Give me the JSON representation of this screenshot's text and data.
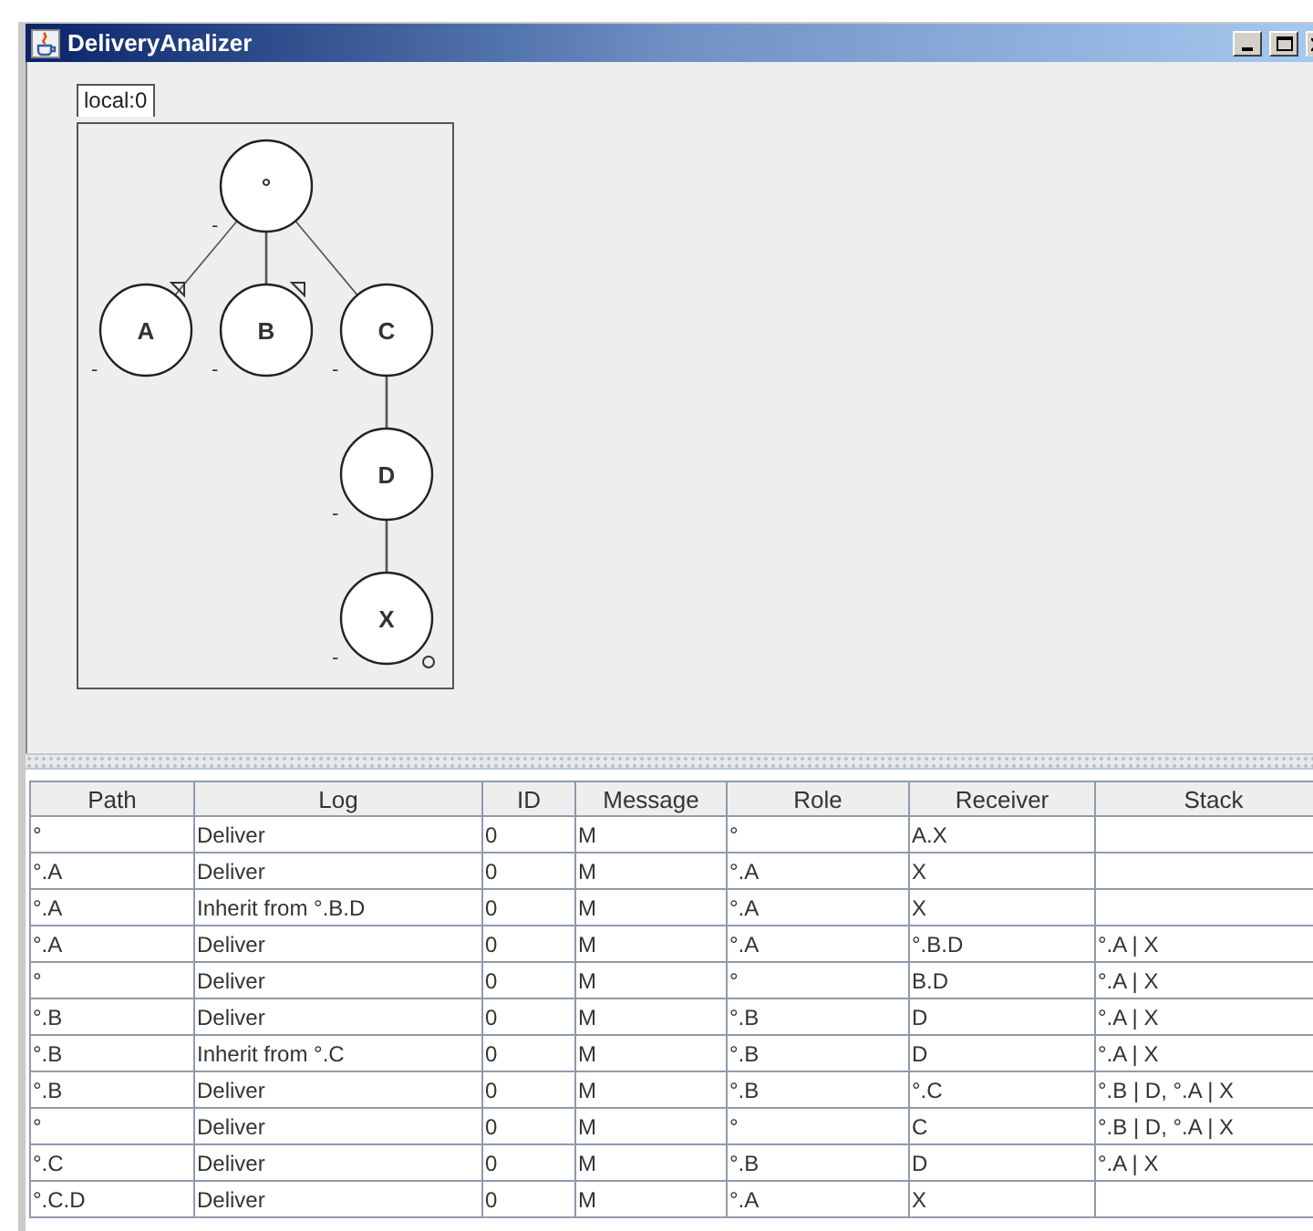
{
  "window": {
    "title": "DeliveryAnalizer"
  },
  "graph": {
    "tab": "local:0",
    "root": {
      "label": "°",
      "toggle": "-",
      "children": [
        {
          "label": "A",
          "toggle": "-",
          "kind": "flagged"
        },
        {
          "label": "B",
          "toggle": "-",
          "kind": "flagged"
        },
        {
          "label": "C",
          "toggle": "-",
          "children": [
            {
              "label": "D",
              "toggle": "-",
              "children": [
                {
                  "label": "X",
                  "toggle": "-",
                  "kind": "terminal"
                }
              ]
            }
          ]
        }
      ]
    }
  },
  "table": {
    "columns": [
      "Path",
      "Log",
      "ID",
      "Message",
      "Role",
      "Receiver",
      "Stack"
    ],
    "rows": [
      [
        "°",
        "Deliver",
        "0",
        "M",
        "°",
        "A.X",
        ""
      ],
      [
        "°.A",
        "Deliver",
        "0",
        "M",
        "°.A",
        "X",
        ""
      ],
      [
        "°.A",
        "Inherit from °.B.D",
        "0",
        "M",
        "°.A",
        "X",
        ""
      ],
      [
        "°.A",
        "Deliver",
        "0",
        "M",
        "°.A",
        "°.B.D",
        "°.A | X"
      ],
      [
        "°",
        "Deliver",
        "0",
        "M",
        "°",
        "B.D",
        "°.A | X"
      ],
      [
        "°.B",
        "Deliver",
        "0",
        "M",
        "°.B",
        "D",
        "°.A | X"
      ],
      [
        "°.B",
        "Inherit from °.C",
        "0",
        "M",
        "°.B",
        "D",
        "°.A | X"
      ],
      [
        "°.B",
        "Deliver",
        "0",
        "M",
        "°.B",
        "°.C",
        "°.B | D, °.A | X"
      ],
      [
        "°",
        "Deliver",
        "0",
        "M",
        "°",
        "C",
        "°.B | D, °.A | X"
      ],
      [
        "°.C",
        "Deliver",
        "0",
        "M",
        "°.B",
        "D",
        "°.A | X"
      ],
      [
        "°.C.D",
        "Deliver",
        "0",
        "M",
        "°.A",
        "X",
        ""
      ]
    ]
  }
}
